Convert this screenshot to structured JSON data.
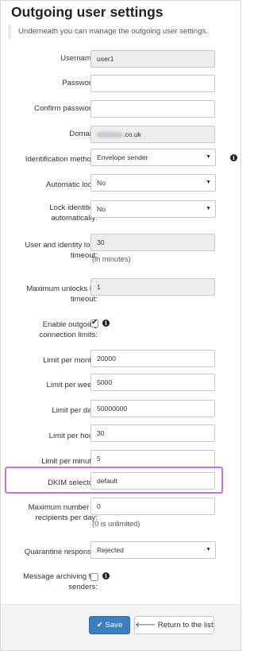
{
  "page": {
    "title": "Outgoing user settings",
    "description": "Underneath you can manage the outgoing user settings."
  },
  "fields": {
    "username": {
      "label": "Username:",
      "value": "user1"
    },
    "password": {
      "label": "Password:",
      "value": ""
    },
    "confirm_password": {
      "label": "Confirm password:",
      "value": ""
    },
    "domain": {
      "label": "Domain:",
      "value_suffix": ".co.uk"
    },
    "identification_method": {
      "label": "Identification method:",
      "value": "Envelope sender"
    },
    "automatic_lock": {
      "label": "Automatic lock:",
      "value": "No"
    },
    "lock_identities": {
      "label_line1": "Lock identities",
      "label_line2": "automatically:",
      "value": "No"
    },
    "lock_timeout": {
      "label_line1": "User and identity lock",
      "label_line2": "timeout:",
      "value": "30",
      "hint": "(in minutes)"
    },
    "max_unlocks": {
      "label_line1": "Maximum unlocks by",
      "label_line2": "timeout:",
      "value": "1"
    },
    "enable_limits": {
      "label_line1": "Enable outgoing",
      "label_line2": "connection limits:",
      "checked": true
    },
    "limit_month": {
      "label": "Limit per month:",
      "value": "20000"
    },
    "limit_week": {
      "label": "Limit per week:",
      "value": "5000"
    },
    "limit_day": {
      "label": "Limit per day:",
      "value": "50000000"
    },
    "limit_hour": {
      "label": "Limit per hour:",
      "value": "30"
    },
    "limit_minute": {
      "label": "Limit per minute:",
      "value": "5"
    },
    "dkim_selector": {
      "label": "DKIM selector:",
      "value": "default"
    },
    "max_recipients": {
      "label_line1": "Maximum number of",
      "label_line2": "recipients per day:",
      "value": "0",
      "hint": "(0 is unlimited)"
    },
    "quarantine_response": {
      "label": "Quarantine response:",
      "value": "Rejected"
    },
    "message_archiving": {
      "label_line1": "Message archiving for",
      "label_line2": "senders:",
      "checked": false
    }
  },
  "buttons": {
    "save": "Save",
    "return": "Return to the list"
  },
  "icons": {
    "info": "info-circle-icon",
    "caret": "caret-down-icon",
    "check": "check-icon",
    "arrow_left": "arrow-left-icon"
  },
  "colors": {
    "primary": "#3c7ebf",
    "highlight": "#c86ff0"
  }
}
